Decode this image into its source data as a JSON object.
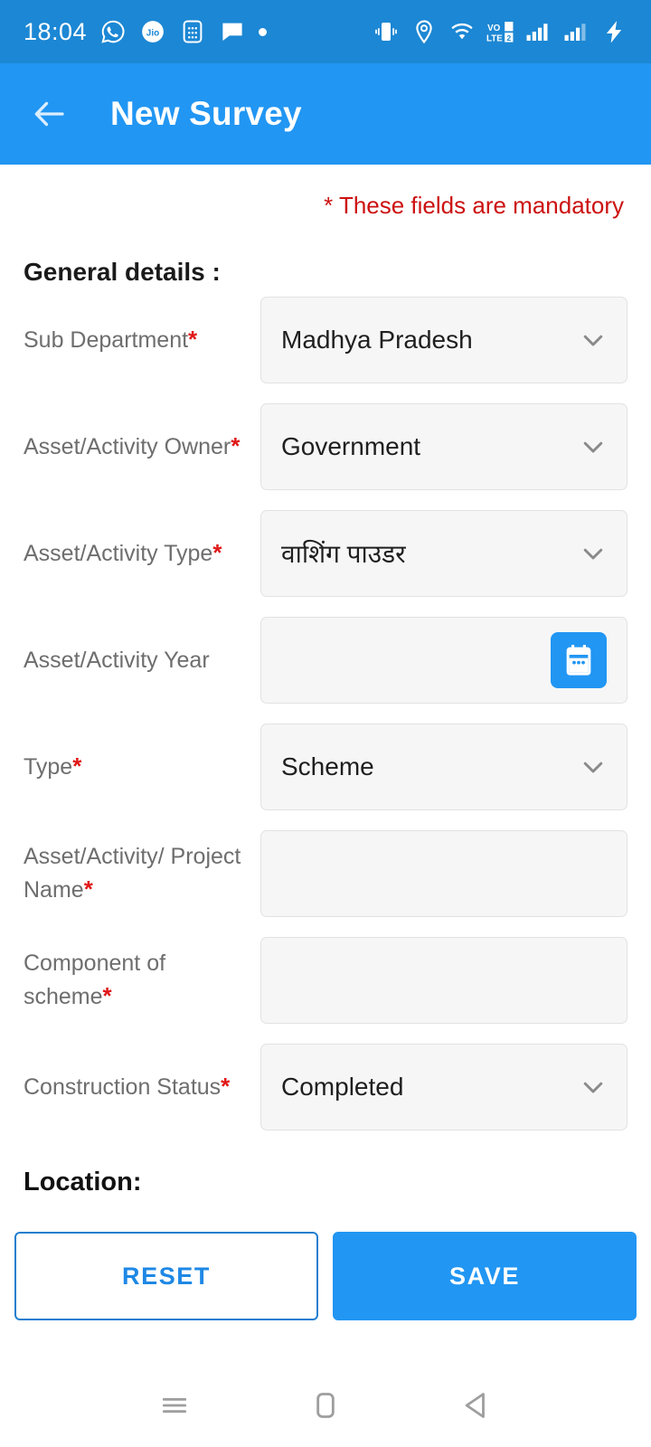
{
  "status_bar": {
    "time": "18:04",
    "left_icons": [
      "whatsapp-icon",
      "jio-icon",
      "calculator-icon",
      "message-icon",
      "dot-indicator"
    ],
    "right_icons": [
      "vibrate-icon",
      "location-icon",
      "wifi-icon",
      "volte-icon",
      "signal-sim1-icon",
      "signal-sim2-icon",
      "charging-bolt-icon"
    ],
    "volte_text_top": "VO",
    "volte_text_bottom": "LTE",
    "volte_sim_label": "2",
    "background": "#1c87d4"
  },
  "app_bar": {
    "title": "New Survey",
    "back_icon": "back-arrow-icon",
    "background": "#2196f3"
  },
  "content": {
    "mandatory_note": "* These fields are mandatory",
    "mandatory_note_color": "#cc1111",
    "section_title": "General details :",
    "location_title": "Location:",
    "fields": [
      {
        "label": "Sub Department",
        "required": true,
        "type": "dropdown",
        "value": "Madhya Pradesh"
      },
      {
        "label": "Asset/Activity Owner",
        "required": true,
        "type": "dropdown",
        "value": "Government"
      },
      {
        "label": "Asset/Activity Type",
        "required": true,
        "type": "dropdown",
        "value": "वाशिंग पाउडर"
      },
      {
        "label": "Asset/Activity Year",
        "required": false,
        "type": "date",
        "value": ""
      },
      {
        "label": "Type",
        "required": true,
        "type": "dropdown",
        "value": "Scheme"
      },
      {
        "label": "Asset/Activity/ Project Name",
        "required": true,
        "type": "text",
        "value": ""
      },
      {
        "label": "Component of scheme",
        "required": true,
        "type": "text",
        "value": ""
      },
      {
        "label": "Construction Status",
        "required": true,
        "type": "dropdown",
        "value": "Completed"
      }
    ]
  },
  "actions": {
    "reset_label": "RESET",
    "save_label": "SAVE",
    "reset_color": "#1e88e5",
    "save_background": "#2196f3"
  },
  "nav_bar": {
    "icons": [
      "recents-menu-icon",
      "home-square-icon",
      "back-triangle-icon"
    ]
  }
}
